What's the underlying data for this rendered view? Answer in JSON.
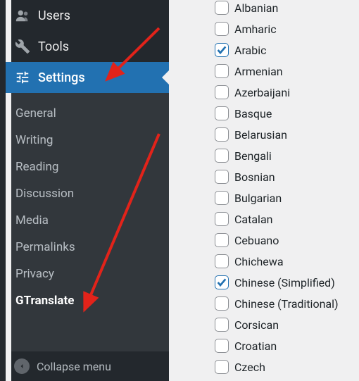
{
  "sidebar": {
    "main_items": [
      {
        "icon": "users-icon",
        "label": "Users"
      },
      {
        "icon": "wrench-icon",
        "label": "Tools"
      },
      {
        "icon": "sliders-icon",
        "label": "Settings",
        "active": true
      }
    ],
    "submenu": [
      {
        "label": "General"
      },
      {
        "label": "Writing"
      },
      {
        "label": "Reading"
      },
      {
        "label": "Discussion"
      },
      {
        "label": "Media"
      },
      {
        "label": "Permalinks"
      },
      {
        "label": "Privacy"
      },
      {
        "label": "GTranslate",
        "current": true
      }
    ],
    "collapse_label": "Collapse menu"
  },
  "languages": [
    {
      "label": "Albanian",
      "checked": false
    },
    {
      "label": "Amharic",
      "checked": false
    },
    {
      "label": "Arabic",
      "checked": true
    },
    {
      "label": "Armenian",
      "checked": false
    },
    {
      "label": "Azerbaijani",
      "checked": false
    },
    {
      "label": "Basque",
      "checked": false
    },
    {
      "label": "Belarusian",
      "checked": false
    },
    {
      "label": "Bengali",
      "checked": false
    },
    {
      "label": "Bosnian",
      "checked": false
    },
    {
      "label": "Bulgarian",
      "checked": false
    },
    {
      "label": "Catalan",
      "checked": false
    },
    {
      "label": "Cebuano",
      "checked": false
    },
    {
      "label": "Chichewa",
      "checked": false
    },
    {
      "label": "Chinese (Simplified)",
      "checked": true
    },
    {
      "label": "Chinese (Traditional)",
      "checked": false
    },
    {
      "label": "Corsican",
      "checked": false
    },
    {
      "label": "Croatian",
      "checked": false
    },
    {
      "label": "Czech",
      "checked": false
    }
  ]
}
